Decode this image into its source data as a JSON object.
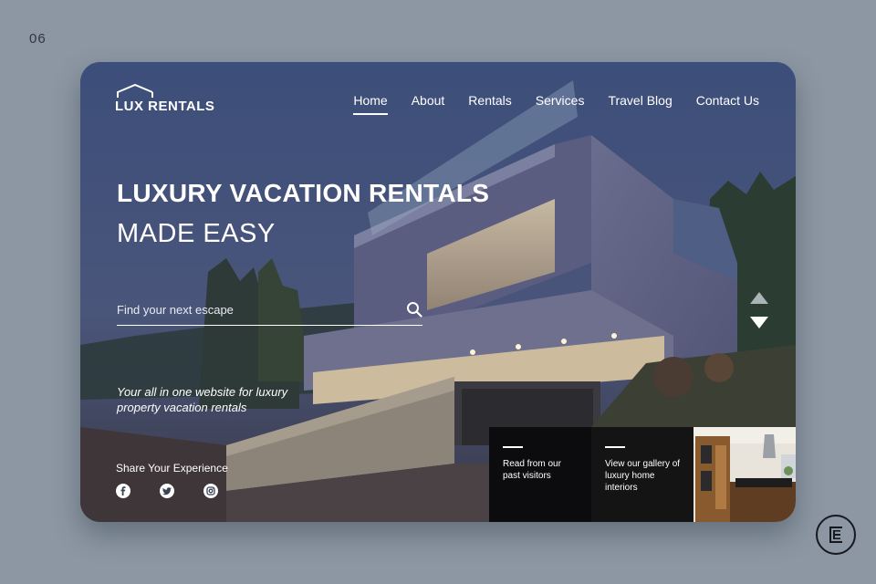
{
  "slide_number": "06",
  "logo": {
    "text": "LUX RENTALS"
  },
  "nav": {
    "items": [
      {
        "label": "Home",
        "active": true
      },
      {
        "label": "About",
        "active": false
      },
      {
        "label": "Rentals",
        "active": false
      },
      {
        "label": "Services",
        "active": false
      },
      {
        "label": "Travel Blog",
        "active": false
      },
      {
        "label": "Contact Us",
        "active": false
      }
    ]
  },
  "hero": {
    "title_line1": "LUXURY VACATION RENTALS",
    "title_line2": "MADE EASY"
  },
  "search": {
    "placeholder": "Find your next escape",
    "value": ""
  },
  "tagline": "Your all in one website for luxury property vacation rentals",
  "share": {
    "label": "Share Your Experience",
    "icons": [
      "facebook-icon",
      "twitter-icon",
      "instagram-icon"
    ]
  },
  "carousel": {
    "prev_icon": "arrow-up-icon",
    "next_icon": "arrow-down-icon"
  },
  "tiles": [
    {
      "text": "Read from our past visitors"
    },
    {
      "text": "View our gallery of luxury home interiors"
    }
  ],
  "colors": {
    "page_bg": "#8c97a3",
    "tile_bg": "#0c0c0e",
    "text": "#ffffff"
  }
}
